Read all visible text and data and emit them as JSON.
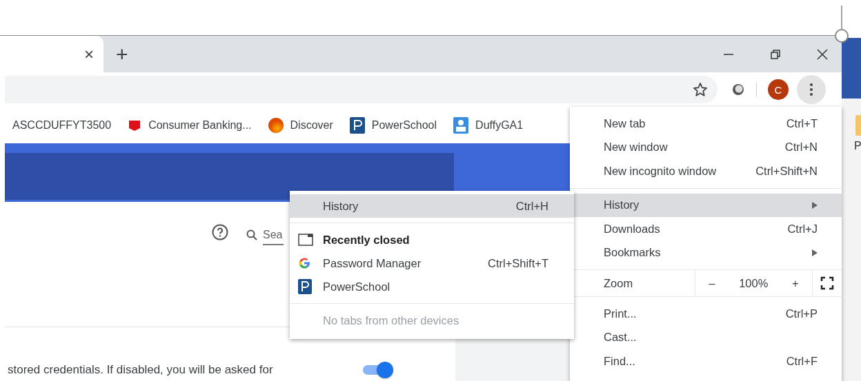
{
  "tab_strip": {
    "close_tab": "×",
    "new_tab": "+"
  },
  "toolbar": {
    "profile_initial": "C"
  },
  "bookmarks": [
    {
      "label": "ASCCDUFFYT3500",
      "kind": "plain"
    },
    {
      "label": "Consumer Banking...",
      "kind": "banner"
    },
    {
      "label": "Discover",
      "kind": "orb"
    },
    {
      "label": "PowerSchool",
      "kind": "tile"
    },
    {
      "label": "DuffyGA1",
      "kind": "user"
    }
  ],
  "page": {
    "search": {
      "placeholder": "Sea"
    },
    "setting_text": "stored credentials. If disabled, you will be asked for",
    "toggle": {
      "on": true
    }
  },
  "behind_window": {
    "text": "P"
  },
  "main_menu": [
    {
      "kind": "item",
      "label": "New tab",
      "shortcut": "Ctrl+T",
      "highlighted": false
    },
    {
      "kind": "item",
      "label": "New window",
      "shortcut": "Ctrl+N",
      "highlighted": false
    },
    {
      "kind": "item",
      "label": "New incognito window",
      "shortcut": "Ctrl+Shift+N",
      "highlighted": false
    },
    {
      "kind": "separator"
    },
    {
      "kind": "submenu",
      "label": "History",
      "highlighted": true
    },
    {
      "kind": "item",
      "label": "Downloads",
      "shortcut": "Ctrl+J",
      "highlighted": false
    },
    {
      "kind": "submenu",
      "label": "Bookmarks",
      "highlighted": false
    },
    {
      "kind": "separator"
    },
    {
      "kind": "zoom",
      "label": "Zoom",
      "minus": "–",
      "value": "100%",
      "plus": "+"
    },
    {
      "kind": "separator"
    },
    {
      "kind": "item",
      "label": "Print...",
      "shortcut": "Ctrl+P",
      "highlighted": false
    },
    {
      "kind": "item",
      "label": "Cast...",
      "highlighted": false
    },
    {
      "kind": "item",
      "label": "Find...",
      "shortcut": "Ctrl+F",
      "highlighted": false
    }
  ],
  "history_submenu": [
    {
      "kind": "item",
      "label": "History",
      "shortcut": "Ctrl+H",
      "highlighted": true
    },
    {
      "kind": "separator"
    },
    {
      "kind": "heading",
      "label": "Recently closed"
    },
    {
      "kind": "multicolor",
      "label": "Password Manager",
      "shortcut": "Ctrl+Shift+T"
    },
    {
      "kind": "tile",
      "label": "PowerSchool"
    },
    {
      "kind": "separator"
    },
    {
      "kind": "note",
      "label": "No tabs from other devices"
    }
  ]
}
